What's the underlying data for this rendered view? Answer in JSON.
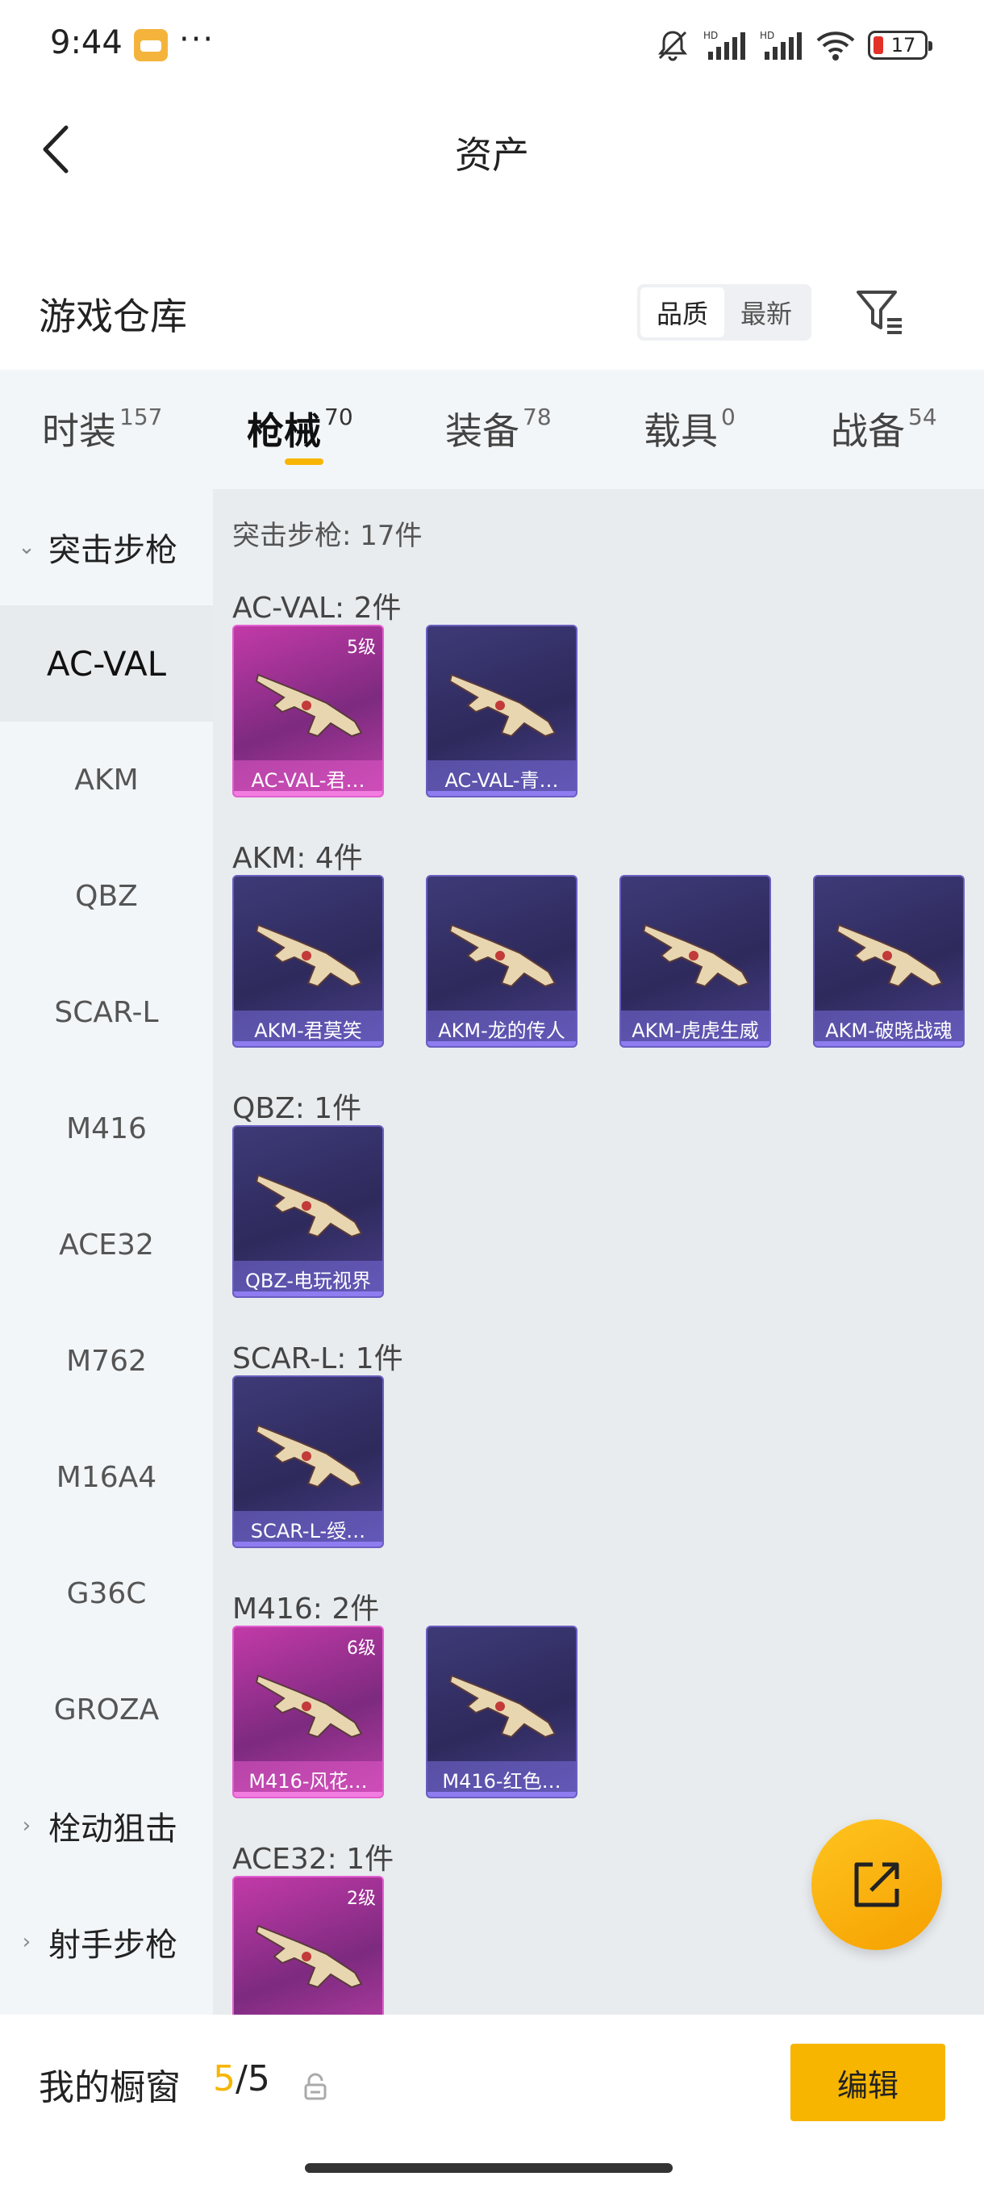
{
  "status": {
    "time": "9:44",
    "dots": "···",
    "battery": "17"
  },
  "header": {
    "title": "资产"
  },
  "section": {
    "title": "游戏仓库",
    "sort_options": [
      "品质",
      "最新"
    ],
    "active_sort": "品质"
  },
  "tabs": [
    {
      "label": "时装",
      "count": "157"
    },
    {
      "label": "枪械",
      "count": "70"
    },
    {
      "label": "装备",
      "count": "78"
    },
    {
      "label": "载具",
      "count": "0"
    },
    {
      "label": "战备",
      "count": "54"
    }
  ],
  "sidebar": {
    "group_open": "突击步枪",
    "items": [
      "AC-VAL",
      "AKM",
      "QBZ",
      "SCAR-L",
      "M416",
      "ACE32",
      "M762",
      "M16A4",
      "G36C",
      "GROZA"
    ],
    "groups_closed": [
      "栓动狙击",
      "射手步枪"
    ]
  },
  "content": {
    "summary": "突击步枪: 17件",
    "groups": [
      {
        "label": "AC-VAL: 2件",
        "cards": [
          {
            "name": "AC-VAL-君…",
            "level": "5级",
            "rarity": "pink"
          },
          {
            "name": "AC-VAL-青…",
            "level": "",
            "rarity": "purple"
          }
        ]
      },
      {
        "label": "AKM: 4件",
        "cards": [
          {
            "name": "AKM-君莫笑",
            "level": "",
            "rarity": "purple"
          },
          {
            "name": "AKM-龙的传人",
            "level": "",
            "rarity": "purple"
          },
          {
            "name": "AKM-虎虎生威",
            "level": "",
            "rarity": "purple"
          },
          {
            "name": "AKM-破晓战魂",
            "level": "",
            "rarity": "purple"
          }
        ]
      },
      {
        "label": "QBZ: 1件",
        "cards": [
          {
            "name": "QBZ-电玩视界",
            "level": "",
            "rarity": "purple"
          }
        ]
      },
      {
        "label": "SCAR-L: 1件",
        "cards": [
          {
            "name": "SCAR-L-绶…",
            "level": "",
            "rarity": "purple"
          }
        ]
      },
      {
        "label": "M416: 2件",
        "cards": [
          {
            "name": "M416-风花…",
            "level": "6级",
            "rarity": "pink"
          },
          {
            "name": "M416-红色…",
            "level": "",
            "rarity": "purple"
          }
        ]
      },
      {
        "label": "ACE32: 1件",
        "cards": [
          {
            "name": "",
            "level": "2级",
            "rarity": "pink"
          }
        ]
      }
    ]
  },
  "bottom": {
    "window_label": "我的橱窗",
    "current": "5",
    "separator": "/",
    "total": "5",
    "edit_label": "编辑"
  },
  "colors": {
    "accent": "#f7b500",
    "card_purple": "#3d3a78",
    "card_pink": "#c23aa8"
  }
}
